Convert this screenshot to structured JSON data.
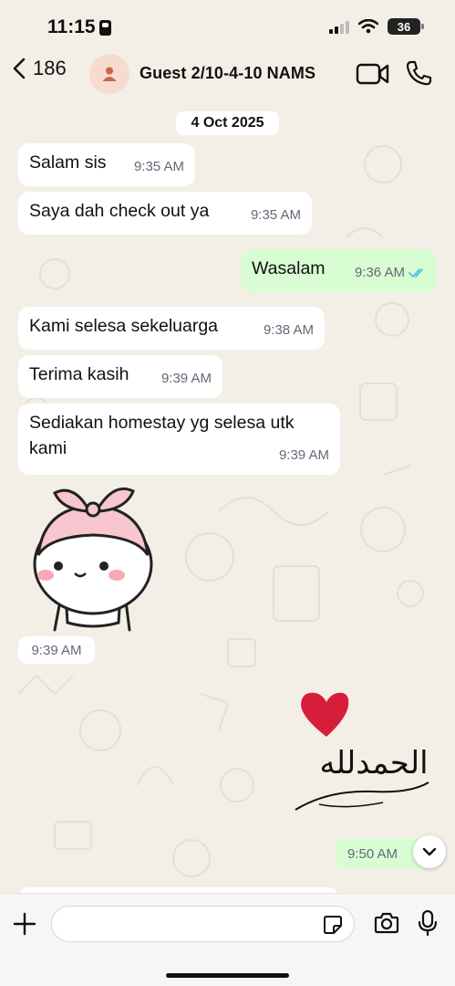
{
  "status_bar": {
    "time": "11:15",
    "battery": "36"
  },
  "header": {
    "back_count": "186",
    "contact_name": "Guest 2/10-4-10 NAMS"
  },
  "date_separator": "4 Oct 2025",
  "messages": [
    {
      "direction": "in",
      "text": "Salam sis",
      "time": "9:35 AM"
    },
    {
      "direction": "in",
      "text": "Saya dah check out ya",
      "time": "9:35 AM"
    },
    {
      "direction": "out",
      "text": "Wasalam",
      "time": "9:36 AM",
      "status": "read"
    },
    {
      "direction": "in",
      "text": "Kami  selesa sekeluarga",
      "time": "9:38 AM"
    },
    {
      "direction": "in",
      "text": "Terima kasih",
      "time": "9:39 AM"
    },
    {
      "direction": "in",
      "text": "Sediakan homestay yg selesa utk kami",
      "time": "9:39 AM"
    },
    {
      "direction": "in",
      "type": "sticker",
      "sticker": "bunny-girl-sticker",
      "time": "9:39 AM"
    },
    {
      "direction": "out",
      "type": "sticker",
      "sticker": "heart-alhamdulillah-sticker",
      "sticker_text": "الحمدلله",
      "time": "9:50 AM"
    }
  ],
  "icons": {
    "back": "chevron-left-icon",
    "avatar": "person-icon",
    "video": "video-camera-icon",
    "phone": "phone-icon",
    "scroll": "chevron-down-icon",
    "attach": "plus-icon",
    "sticker": "sticker-icon",
    "camera": "camera-icon",
    "mic": "microphone-icon"
  },
  "colors": {
    "background": "#f4efe6",
    "incoming_bubble": "#ffffff",
    "outgoing_bubble": "#d9fdd3",
    "read_ticks": "#53bdeb",
    "avatar_bg": "#f6dcd0",
    "avatar_fg": "#c9664a",
    "heart": "#d61e3a"
  }
}
